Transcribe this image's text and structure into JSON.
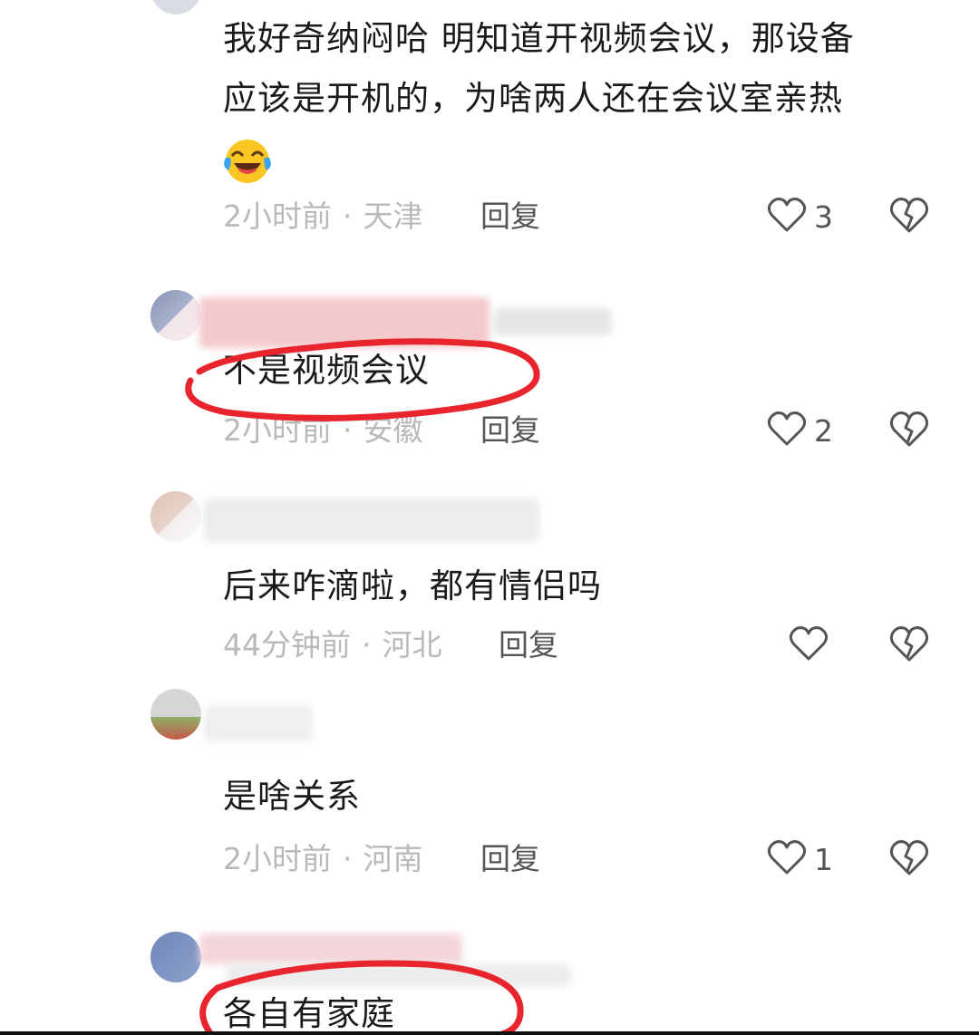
{
  "comments": [
    {
      "text_line1": "我好奇纳闷哈 明知道开视频会议，那设备",
      "text_line2": "应该是开机的，为啥两人还在会议室亲热",
      "emoji": "laughing-crying-emoji",
      "time": "2小时前",
      "location": "天津",
      "reply_label": "回复",
      "like_count": "3"
    },
    {
      "text": "不是视频会议",
      "time": "2小时前",
      "location": "安徽",
      "reply_label": "回复",
      "like_count": "2"
    },
    {
      "text": "后来咋滴啦，都有情侣吗",
      "time": "44分钟前",
      "location": "河北",
      "reply_label": "回复",
      "like_count": ""
    },
    {
      "text": "是啥关系",
      "time": "2小时前",
      "location": "河南",
      "reply_label": "回复",
      "like_count": "1"
    },
    {
      "text": "各自有家庭"
    }
  ],
  "separator": "·",
  "icons": {
    "like": "heart-outline-icon",
    "dislike": "broken-heart-icon"
  },
  "colors": {
    "annotation_red": "#e8242d",
    "meta_gray": "#b9b9b9",
    "text": "#1a1a1a"
  }
}
